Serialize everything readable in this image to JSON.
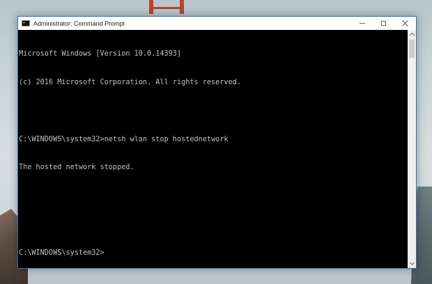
{
  "window": {
    "title": "Administrator: Command Prompt",
    "caption_buttons": {
      "minimize_icon": "minimize-icon",
      "maximize_icon": "maximize-icon",
      "close_icon": "close-icon"
    }
  },
  "console": {
    "lines": [
      "Microsoft Windows [Version 10.0.14393]",
      "(c) 2016 Microsoft Corporation. All rights reserved.",
      "",
      "C:\\WINDOWS\\system32>netsh wlan stop hostednetwork",
      "The hosted network stopped.",
      "",
      "",
      "C:\\WINDOWS\\system32>"
    ],
    "text_color": "#c0c0c0",
    "background_color": "#000000"
  },
  "scrollbar": {
    "up_icon": "chevron-up-icon",
    "down_icon": "chevron-down-icon"
  },
  "colors": {
    "window_border": "#3b6f9e",
    "titlebar": "#ffffff"
  }
}
